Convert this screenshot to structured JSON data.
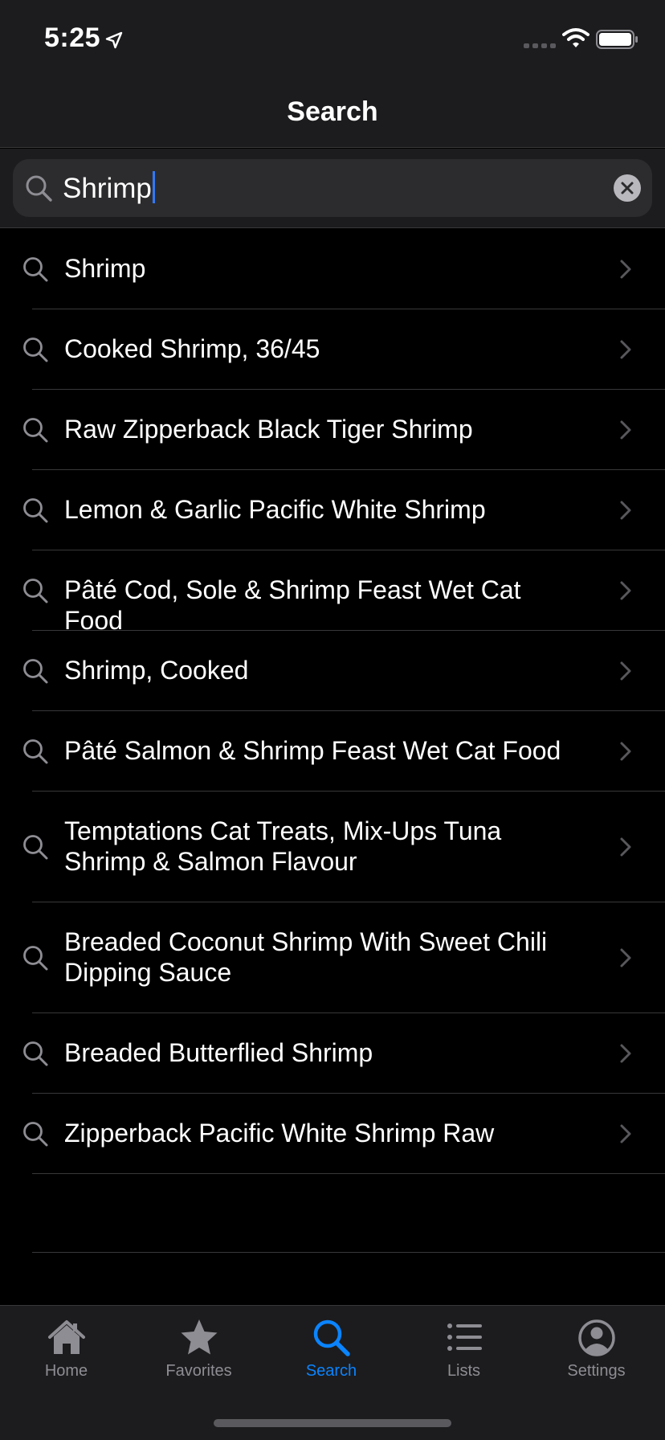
{
  "status": {
    "time": "5:25"
  },
  "nav": {
    "title": "Search"
  },
  "search": {
    "value": "Shrimp"
  },
  "results": [
    "Shrimp",
    "Cooked Shrimp, 36/45",
    "Raw Zipperback Black Tiger Shrimp",
    "Lemon & Garlic Pacific White Shrimp",
    "Pâté Cod, Sole & Shrimp Feast Wet Cat Food",
    "Shrimp, Cooked",
    "Pâté Salmon & Shrimp Feast Wet Cat Food",
    "Temptations Cat Treats, Mix-Ups Tuna Shrimp & Salmon Flavour",
    "Breaded Coconut Shrimp With Sweet Chili Dipping Sauce",
    "Breaded Butterflied Shrimp",
    "Zipperback Pacific White Shrimp Raw"
  ],
  "tabs": [
    {
      "label": "Home",
      "icon": "house-icon",
      "active": false
    },
    {
      "label": "Favorites",
      "icon": "star-icon",
      "active": false
    },
    {
      "label": "Search",
      "icon": "search-icon",
      "active": true
    },
    {
      "label": "Lists",
      "icon": "list-icon",
      "active": false
    },
    {
      "label": "Settings",
      "icon": "person-circle-icon",
      "active": false
    }
  ],
  "colors": {
    "accent": "#0a84ff",
    "background": "#000000",
    "bar": "#1c1c1e",
    "field": "#2c2c2e",
    "inactive": "#8d8d93"
  }
}
